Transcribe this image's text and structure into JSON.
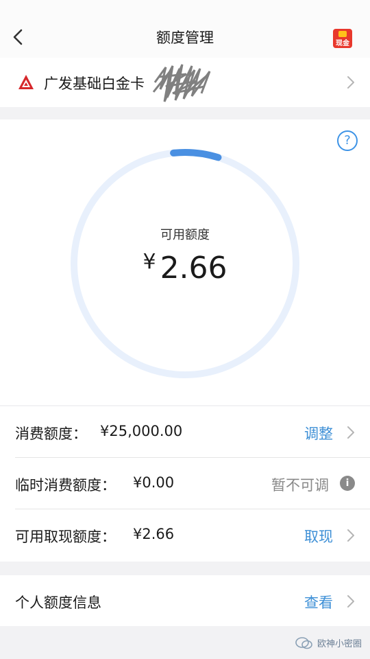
{
  "header": {
    "title": "额度管理",
    "cash_label": "现金"
  },
  "card": {
    "name": "广发基础白金卡"
  },
  "quota": {
    "label": "可用额度",
    "currency": "¥",
    "amount": "2.66",
    "help": "?",
    "progress": 0.13
  },
  "rows": [
    {
      "label": "消费额度：",
      "value": "¥25,000.00",
      "action": "调整"
    },
    {
      "label": "临时消费额度：",
      "value": "¥0.00",
      "action": "暂不可调"
    },
    {
      "label": "可用取现额度：",
      "value": "¥2.66",
      "action": "取现"
    }
  ],
  "personal": {
    "label": "个人额度信息",
    "action": "查看"
  },
  "watermark": {
    "text": "欧神小密圈"
  },
  "colors": {
    "accent": "#3d8fd6",
    "ring_track": "#e8f0fc",
    "ring_progress": "#4a90e2",
    "bank_red": "#d6272b"
  }
}
